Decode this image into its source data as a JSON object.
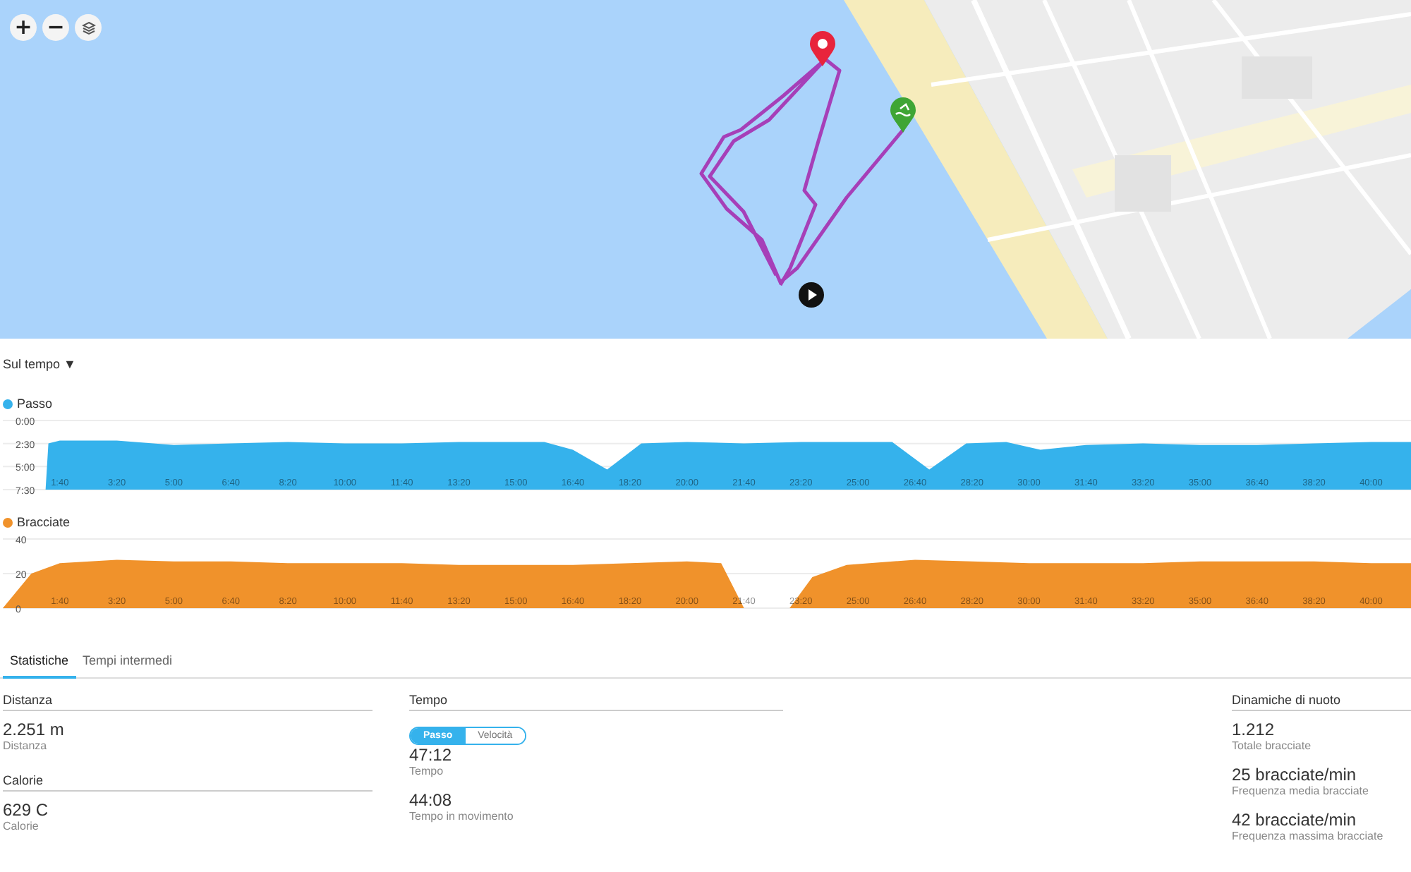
{
  "map": {
    "controls": [
      {
        "kind": "zoom-in",
        "label": "+"
      },
      {
        "kind": "zoom-out",
        "label": "−"
      },
      {
        "kind": "layers"
      }
    ]
  },
  "view_selector": {
    "label": "Sul tempo",
    "caret": "▼"
  },
  "charts": [
    {
      "chart_data": {
        "type": "area",
        "x": [
          75,
          80,
          100,
          200,
          300,
          400,
          500,
          600,
          700,
          800,
          900,
          950,
          1000,
          1060,
          1120,
          1200,
          1300,
          1400,
          1500,
          1560,
          1625,
          1690,
          1760,
          1820,
          1900,
          2000,
          2100,
          2200,
          2300,
          2400,
          2470
        ],
        "xlim": [
          0,
          2470
        ],
        "ylim": [
          450,
          0
        ],
        "series": [
          {
            "name": "Passo",
            "color": "#35b2ec",
            "values": [
              450,
              150,
              130,
              130,
              160,
              150,
              140,
              150,
              150,
              140,
              140,
              140,
              190,
              320,
              150,
              140,
              150,
              140,
              140,
              140,
              320,
              150,
              140,
              190,
              160,
              150,
              160,
              160,
              150,
              140,
              140
            ]
          }
        ],
        "yticks": [
          {
            "value": 0,
            "label": "0:00"
          },
          {
            "value": 150,
            "label": "2:30"
          },
          {
            "value": 300,
            "label": "5:00"
          },
          {
            "value": 450,
            "label": "7:30"
          }
        ],
        "xticks": [
          {
            "value": 100,
            "label": "1:40"
          },
          {
            "value": 200,
            "label": "3:20"
          },
          {
            "value": 300,
            "label": "5:00"
          },
          {
            "value": 400,
            "label": "6:40"
          },
          {
            "value": 500,
            "label": "8:20"
          },
          {
            "value": 600,
            "label": "10:00"
          },
          {
            "value": 700,
            "label": "11:40"
          },
          {
            "value": 800,
            "label": "13:20"
          },
          {
            "value": 900,
            "label": "15:00"
          },
          {
            "value": 1000,
            "label": "16:40"
          },
          {
            "value": 1100,
            "label": "18:20"
          },
          {
            "value": 1200,
            "label": "20:00"
          },
          {
            "value": 1300,
            "label": "21:40"
          },
          {
            "value": 1400,
            "label": "23:20"
          },
          {
            "value": 1500,
            "label": "25:00"
          },
          {
            "value": 1600,
            "label": "26:40"
          },
          {
            "value": 1700,
            "label": "28:20"
          },
          {
            "value": 1800,
            "label": "30:00"
          },
          {
            "value": 1900,
            "label": "31:40"
          },
          {
            "value": 2000,
            "label": "33:20"
          },
          {
            "value": 2100,
            "label": "35:00"
          },
          {
            "value": 2200,
            "label": "36:40"
          },
          {
            "value": 2300,
            "label": "38:20"
          },
          {
            "value": 2400,
            "label": "40:00"
          }
        ]
      }
    },
    {
      "chart_data": {
        "type": "area",
        "x": [
          0,
          50,
          100,
          200,
          300,
          400,
          500,
          600,
          700,
          800,
          900,
          1000,
          1100,
          1200,
          1260,
          1300,
          1380,
          1420,
          1480,
          1600,
          1700,
          1800,
          1900,
          2000,
          2100,
          2200,
          2300,
          2400,
          2470
        ],
        "xlim": [
          0,
          2470
        ],
        "ylim": [
          0,
          40
        ],
        "series": [
          {
            "name": "Bracciate",
            "color": "#f0922b",
            "values": [
              0,
              20,
              26,
              28,
              27,
              27,
              26,
              26,
              26,
              25,
              25,
              25,
              26,
              27,
              26,
              0,
              0,
              18,
              25,
              28,
              27,
              26,
              26,
              26,
              27,
              27,
              27,
              26,
              26
            ]
          }
        ],
        "yticks": [
          {
            "value": 0,
            "label": "0"
          },
          {
            "value": 20,
            "label": "20"
          },
          {
            "value": 40,
            "label": "40"
          }
        ],
        "xticks": [
          {
            "value": 100,
            "label": "1:40"
          },
          {
            "value": 200,
            "label": "3:20"
          },
          {
            "value": 300,
            "label": "5:00"
          },
          {
            "value": 400,
            "label": "6:40"
          },
          {
            "value": 500,
            "label": "8:20"
          },
          {
            "value": 600,
            "label": "10:00"
          },
          {
            "value": 700,
            "label": "11:40"
          },
          {
            "value": 800,
            "label": "13:20"
          },
          {
            "value": 900,
            "label": "15:00"
          },
          {
            "value": 1000,
            "label": "16:40"
          },
          {
            "value": 1100,
            "label": "18:20"
          },
          {
            "value": 1200,
            "label": "20:00"
          },
          {
            "value": 1300,
            "label": "21:40"
          },
          {
            "value": 1400,
            "label": "23:20"
          },
          {
            "value": 1500,
            "label": "25:00"
          },
          {
            "value": 1600,
            "label": "26:40"
          },
          {
            "value": 1700,
            "label": "28:20"
          },
          {
            "value": 1800,
            "label": "30:00"
          },
          {
            "value": 1900,
            "label": "31:40"
          },
          {
            "value": 2000,
            "label": "33:20"
          },
          {
            "value": 2100,
            "label": "35:00"
          },
          {
            "value": 2200,
            "label": "36:40"
          },
          {
            "value": 2300,
            "label": "38:20"
          },
          {
            "value": 2400,
            "label": "40:00"
          }
        ]
      }
    }
  ],
  "tabs": [
    {
      "label": "Statistiche",
      "selected": true
    },
    {
      "label": "Tempi intermedi",
      "selected": false
    }
  ],
  "stat_columns": [
    {
      "groups": [
        {
          "heading": "Distanza",
          "items": [
            {
              "value": "2.251 m",
              "label": "Distanza"
            }
          ]
        },
        {
          "heading": "Calorie",
          "items": [
            {
              "value": "629 C",
              "label": "Calorie"
            }
          ]
        }
      ]
    },
    {
      "groups": [
        {
          "heading": "Tempo",
          "toggle": [
            {
              "label": "Passo",
              "selected": true
            },
            {
              "label": "Velocità",
              "selected": false
            }
          ],
          "items": [
            {
              "value": "47:12",
              "label": "Tempo"
            },
            {
              "value": "44:08",
              "label": "Tempo in movimento"
            }
          ]
        }
      ]
    },
    {
      "groups": [
        {
          "heading": "Dinamiche di nuoto",
          "items": [
            {
              "value": "1.212",
              "label": "Totale bracciate"
            },
            {
              "value": "25 bracciate/min",
              "label": "Frequenza media bracciate"
            },
            {
              "value": "42 bracciate/min",
              "label": "Frequenza massima bracciate"
            }
          ]
        }
      ]
    }
  ]
}
